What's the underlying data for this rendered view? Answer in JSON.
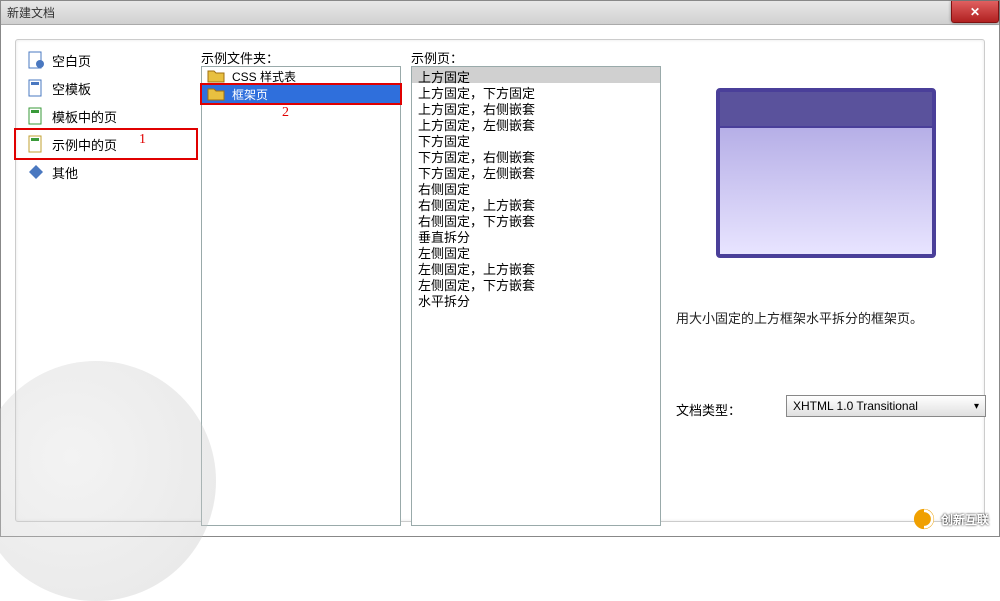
{
  "dialog": {
    "title": "新建文档",
    "close_label": "✕"
  },
  "categories": [
    {
      "id": "blank-page",
      "label": "空白页"
    },
    {
      "id": "blank-tmpl",
      "label": "空模板"
    },
    {
      "id": "tmpl-page",
      "label": "模板中的页"
    },
    {
      "id": "sample-page",
      "label": "示例中的页",
      "selected": true,
      "annot": "1"
    },
    {
      "id": "other",
      "label": "其他"
    }
  ],
  "folders": {
    "heading": "示例文件夹：",
    "items": [
      {
        "label": "CSS 样式表"
      },
      {
        "label": "框架页",
        "selected": true,
        "annot": "2"
      }
    ]
  },
  "pages": {
    "heading": "示例页：",
    "items": [
      {
        "label": "上方固定",
        "selected": true
      },
      {
        "label": "上方固定，下方固定"
      },
      {
        "label": "上方固定，右侧嵌套"
      },
      {
        "label": "上方固定，左侧嵌套"
      },
      {
        "label": "下方固定"
      },
      {
        "label": "下方固定，右侧嵌套"
      },
      {
        "label": "下方固定，左侧嵌套"
      },
      {
        "label": "右侧固定"
      },
      {
        "label": "右侧固定，上方嵌套"
      },
      {
        "label": "右侧固定，下方嵌套"
      },
      {
        "label": "垂直拆分"
      },
      {
        "label": "左侧固定"
      },
      {
        "label": "左侧固定，上方嵌套"
      },
      {
        "label": "左侧固定，下方嵌套"
      },
      {
        "label": "水平拆分"
      }
    ]
  },
  "preview": {
    "description": "用大小固定的上方框架水平拆分的框架页。"
  },
  "doctype": {
    "label": "文档类型：",
    "value": "XHTML 1.0 Transitional"
  },
  "brand": {
    "text": "创新互联"
  },
  "icons": {
    "folder_color": "#e8c040",
    "chev": "▾"
  }
}
